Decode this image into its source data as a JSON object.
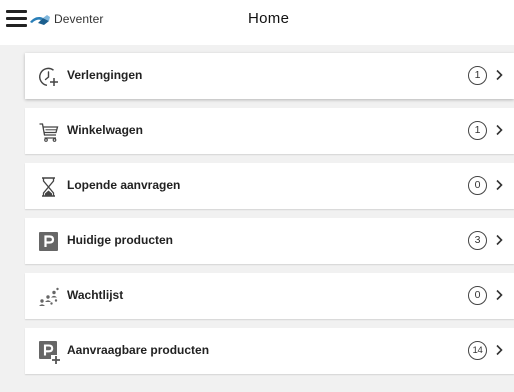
{
  "header": {
    "brand": "Deventer",
    "title": "Home",
    "menu_icon": "hamburger-menu-icon",
    "logo_icon": "deventer-logo-icon"
  },
  "colors": {
    "page_background": "#f1f1f1",
    "card_background": "#ffffff",
    "product_icon": "#666666",
    "logo_blue": "#2a7fb8"
  },
  "items": [
    {
      "label": "Verlengingen",
      "count": "1",
      "icon": "clock-plus-icon"
    },
    {
      "label": "Winkelwagen",
      "count": "1",
      "icon": "cart-icon"
    },
    {
      "label": "Lopende aanvragen",
      "count": "0",
      "icon": "hourglass-icon"
    },
    {
      "label": "Huidige producten",
      "count": "3",
      "icon": "parking-icon"
    },
    {
      "label": "Wachtlijst",
      "count": "0",
      "icon": "people-queue-icon"
    },
    {
      "label": "Aanvraagbare producten",
      "count": "14",
      "icon": "parking-plus-icon"
    }
  ]
}
